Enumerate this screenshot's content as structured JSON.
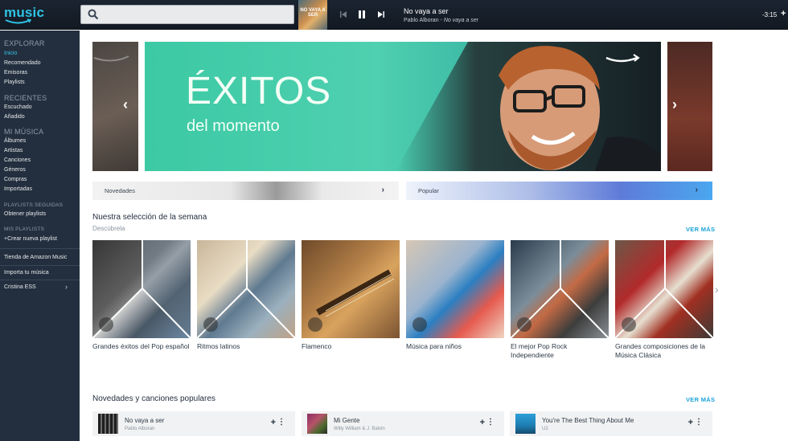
{
  "app": {
    "logo_text": "music"
  },
  "search": {
    "placeholder": ""
  },
  "player": {
    "album_art_text": "NO VAYA A SER",
    "title": "No vaya a ser",
    "artist": "Pablo Alboran",
    "separator": " - ",
    "album": "No vaya a ser",
    "time_remaining": "-3:15",
    "add_symbol": "+"
  },
  "sidebar": {
    "explore": {
      "heading": "EXPLORAR",
      "items": [
        {
          "label": "Inicio"
        },
        {
          "label": "Recomendado"
        },
        {
          "label": "Emisoras"
        },
        {
          "label": "Playlists"
        }
      ]
    },
    "recent": {
      "heading": "RECIENTES",
      "items": [
        {
          "label": "Escuchado"
        },
        {
          "label": "Añadido"
        }
      ]
    },
    "my_music": {
      "heading": "MI MÚSICA",
      "items": [
        {
          "label": "Álbumes"
        },
        {
          "label": "Artistas"
        },
        {
          "label": "Canciones"
        },
        {
          "label": "Géneros"
        },
        {
          "label": "Compras"
        },
        {
          "label": "Importadas"
        }
      ]
    },
    "followed": {
      "heading": "PLAYLISTS SEGUIDAS",
      "item": "Obtener playlists"
    },
    "my_playlists": {
      "heading": "MIS PLAYLISTS",
      "item": "+Crear nueva playlist"
    },
    "store": "Tienda de Amazon Music",
    "import": "Importa tu música",
    "account": "Cristina ESS"
  },
  "hero": {
    "title": "ÉXITOS",
    "subtitle": "del momento"
  },
  "pills": [
    {
      "label": "Novedades"
    },
    {
      "label": "Popular"
    }
  ],
  "selection": {
    "title": "Nuestra selección de la semana",
    "subtitle": "Descúbrela",
    "see_more": "VER MÁS",
    "cards": [
      {
        "label": "Grandes éxitos del Pop español"
      },
      {
        "label": "Ritmos latinos"
      },
      {
        "label": "Flamenco"
      },
      {
        "label": "Música para niños"
      },
      {
        "label": "El mejor Pop Rock Independiente"
      },
      {
        "label": "Grandes composiciones de la Música Clásica"
      }
    ]
  },
  "new_songs": {
    "title": "Novedades y canciones populares",
    "see_more": "VER MÁS",
    "songs": [
      {
        "title": "No vaya a ser",
        "artist": "Pablo Alboran"
      },
      {
        "title": "Mi Gente",
        "artist": "Willy William & J. Balvin"
      },
      {
        "title": "You're The Best Thing About Me",
        "artist": "U2"
      }
    ]
  },
  "colors": {
    "accent": "#1aa3d9",
    "sidebar_bg": "#232f3e",
    "topbar_bg": "#161e28",
    "hero_teal": "#3cc9a4"
  }
}
